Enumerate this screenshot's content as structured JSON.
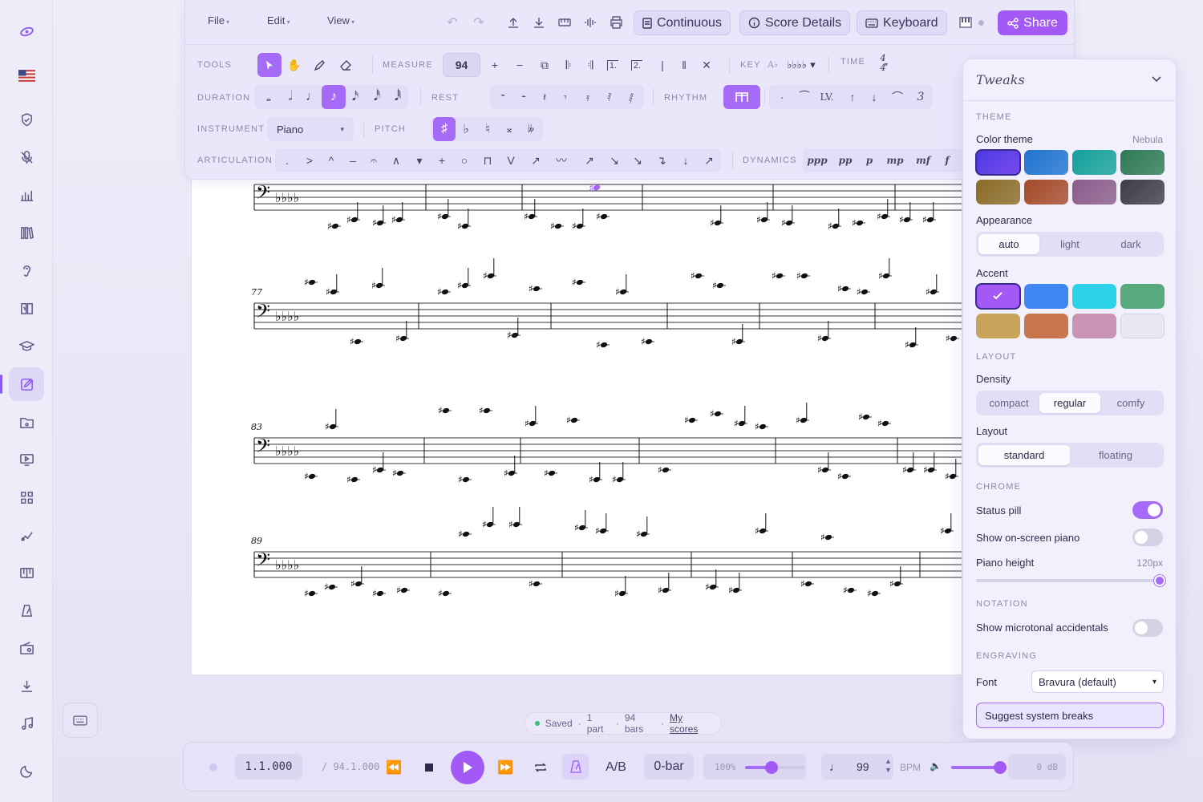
{
  "toolbar": {
    "menus": [
      "File",
      "Edit",
      "View"
    ],
    "continuous_label": "Continuous",
    "score_details_label": "Score Details",
    "keyboard_label": "Keyboard",
    "share_label": "Share",
    "tools_label": "TOOLS",
    "measure_label": "MEASURE",
    "measure_value": "94",
    "key_label": "KEY",
    "time_label": "TIME",
    "time_sig": {
      "top": "4",
      "bottom": "4"
    },
    "duration_label": "DURATION",
    "rest_label": "REST",
    "rhythm_label": "RHYTHM",
    "instrument_label": "INSTRUMENT",
    "instrument_value": "Piano",
    "pitch_label": "PITCH",
    "articulation_label": "ARTICULATION",
    "dynamics_label": "DYNAMICS",
    "dynamics": [
      "ppp",
      "pp",
      "p",
      "mp",
      "mf",
      "f"
    ],
    "rhythm_lv": "LV.",
    "rhythm_triplet": "3"
  },
  "score": {
    "measure_numbers": [
      "77",
      "83",
      "89"
    ]
  },
  "tweaks": {
    "title": "Tweaks",
    "theme_section": "THEME",
    "color_theme_label": "Color theme",
    "color_theme_value": "Nebula",
    "theme_swatches": [
      "#5b3ee0",
      "#1f73d0",
      "#13a09a",
      "#2d7a55",
      "#8a6a25",
      "#a44a28",
      "#8a5b8a",
      "#3c3d48"
    ],
    "appearance_label": "Appearance",
    "appearance_options": [
      "auto",
      "light",
      "dark"
    ],
    "appearance_selected": "auto",
    "accent_label": "Accent",
    "accent_swatches": [
      "#a259f5",
      "#3f86f0",
      "#2cd2e8",
      "#58a97e",
      "#c8a35a",
      "#c8764d",
      "#c896b4",
      "#e9e7ef"
    ],
    "layout_section": "LAYOUT",
    "density_label": "Density",
    "density_options": [
      "compact",
      "regular",
      "comfy"
    ],
    "density_selected": "regular",
    "layout_label": "Layout",
    "layout_options": [
      "standard",
      "floating"
    ],
    "layout_selected": "standard",
    "chrome_section": "CHROME",
    "status_pill_label": "Status pill",
    "status_pill_on": true,
    "piano_label": "Show on-screen piano",
    "piano_on": false,
    "piano_height_label": "Piano height",
    "piano_height_value": "120px",
    "notation_section": "NOTATION",
    "microtonal_label": "Show microtonal accidentals",
    "microtonal_on": false,
    "engraving_section": "ENGRAVING",
    "font_label": "Font",
    "font_value": "Bravura (default)",
    "suggest_label": "Suggest system breaks"
  },
  "status": {
    "saved": "Saved",
    "parts": "1 part",
    "bars": "94 bars",
    "my_scores": "My scores"
  },
  "transport": {
    "position": "1.1.000",
    "total": "/ 94.1.000",
    "ab_label": "A/B",
    "obar_label": "0-bar",
    "zoom": "100%",
    "zoom_level": 0.45,
    "tempo": "99",
    "bpm_label": "BPM",
    "volume_level": 0.98,
    "db": "0 dB"
  },
  "colors": {
    "accent": "#a259f5",
    "panel": "#f2f0fc"
  }
}
